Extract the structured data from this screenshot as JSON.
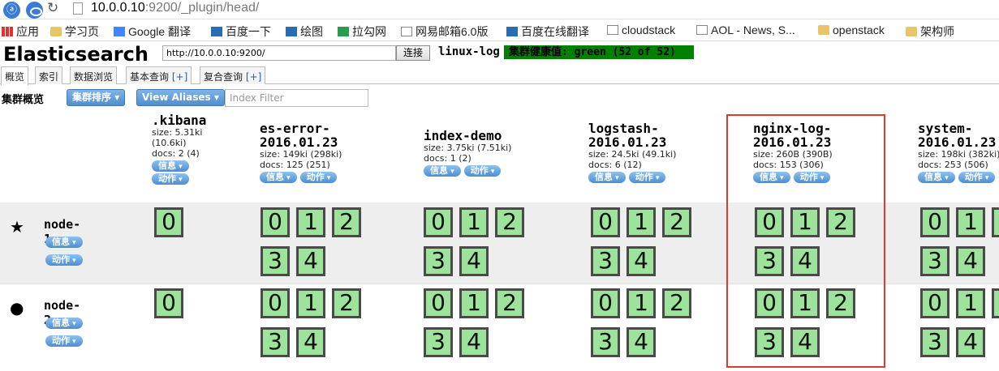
{
  "browser": {
    "address": "10.0.0.10:9200/_plugin/head/",
    "address_host": "10.0.0.10",
    "address_rest": ":9200/_plugin/head/",
    "bookmarks": [
      {
        "label": "应用",
        "icon": "apps-grid-icon"
      },
      {
        "label": "学习页",
        "icon": "folder-icon"
      },
      {
        "label": "Google 翻译",
        "icon": "google-translate-icon"
      },
      {
        "label": "百度一下",
        "icon": "baidu-icon"
      },
      {
        "label": "绘图",
        "icon": "draw-icon"
      },
      {
        "label": "拉勾网",
        "icon": "lagou-icon"
      },
      {
        "label": "网易邮箱6.0版",
        "icon": "page-icon"
      },
      {
        "label": "百度在线翻译",
        "icon": "baidu-translate-icon"
      },
      {
        "label": "cloudstack",
        "icon": "page-icon"
      },
      {
        "label": "AOL - News, S...",
        "icon": "page-icon"
      },
      {
        "label": "openstack",
        "icon": "folder-icon"
      },
      {
        "label": "架构师",
        "icon": "folder-icon"
      }
    ]
  },
  "header": {
    "title": "Elasticsearch",
    "cluster_url": "http://10.0.0.10:9200/",
    "connect_label": "连接",
    "cluster_name": "linux-log",
    "health_text": "集群健康值: green (52 of 52)",
    "health_color": "#008000"
  },
  "tabs": [
    {
      "label": "概览"
    },
    {
      "label": "索引"
    },
    {
      "label": "数据浏览"
    },
    {
      "label": "基本查询",
      "plus": "[+]"
    },
    {
      "label": "复合查询",
      "plus": "[+]"
    }
  ],
  "overview": {
    "label": "集群概览",
    "sort_label": "集群排序",
    "aliases_label": "View Aliases",
    "filter_placeholder": "Index Filter"
  },
  "menus": {
    "info": "信息",
    "action": "动作"
  },
  "indices": [
    {
      "name": ".kibana",
      "size": "size: 5.31ki",
      "size2": "(10.6ki)",
      "docs": "docs: 2 (4)"
    },
    {
      "name": "es-error-",
      "name2": "2016.01.23",
      "size": "size: 149ki (298ki)",
      "docs": "docs: 125 (251)"
    },
    {
      "name": "index-demo",
      "size": "size: 3.75ki (7.51ki)",
      "docs": "docs: 1 (2)"
    },
    {
      "name": "logstash-",
      "name2": "2016.01.23",
      "size": "size: 24.5ki (49.1ki)",
      "docs": "docs: 6 (12)"
    },
    {
      "name": "nginx-log-",
      "name2": "2016.01.23",
      "size": "size: 260B (390B)",
      "docs": "docs: 153 (306)"
    },
    {
      "name": "system-",
      "name2": "2016.01.23",
      "size": "size: 198ki (382ki)",
      "docs": "docs: 253 (506)"
    }
  ],
  "nodes": [
    {
      "name": "node-1",
      "symbol": "★",
      "role": "master"
    },
    {
      "name": "node-2",
      "symbol": "●",
      "role": "data"
    }
  ],
  "shards": {
    "kibana": [
      "0"
    ],
    "full": [
      "0",
      "1",
      "2",
      "3",
      "4"
    ],
    "shard_color": "#9ee39b"
  }
}
